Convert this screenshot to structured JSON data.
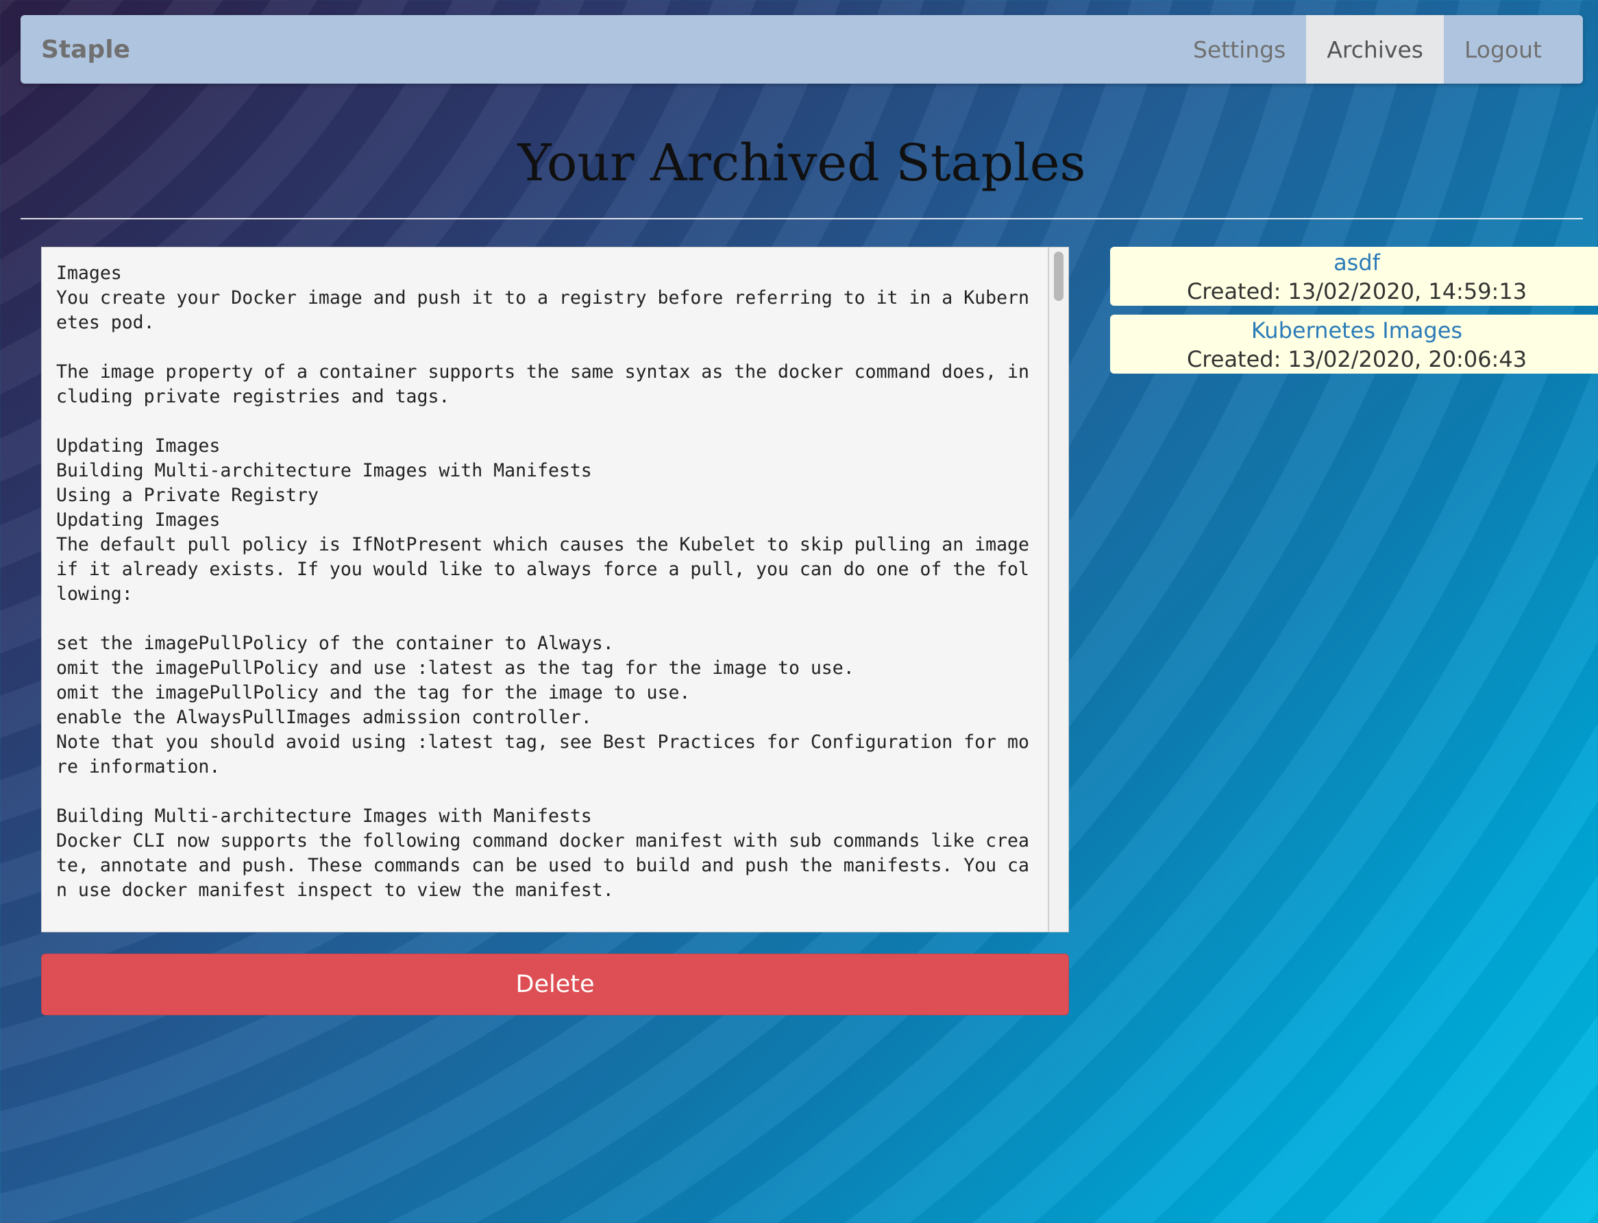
{
  "navbar": {
    "brand": "Staple",
    "links": [
      {
        "label": "Settings",
        "active": false
      },
      {
        "label": "Archives",
        "active": true
      },
      {
        "label": "Logout",
        "active": false
      }
    ]
  },
  "page": {
    "title": "Your Archived Staples"
  },
  "editor": {
    "content": "Images\nYou create your Docker image and push it to a registry before referring to it in a Kubernetes pod.\n\nThe image property of a container supports the same syntax as the docker command does, including private registries and tags.\n\nUpdating Images\nBuilding Multi-architecture Images with Manifests\nUsing a Private Registry\nUpdating Images\nThe default pull policy is IfNotPresent which causes the Kubelet to skip pulling an image if it already exists. If you would like to always force a pull, you can do one of the following:\n\nset the imagePullPolicy of the container to Always.\nomit the imagePullPolicy and use :latest as the tag for the image to use.\nomit the imagePullPolicy and the tag for the image to use.\nenable the AlwaysPullImages admission controller.\nNote that you should avoid using :latest tag, see Best Practices for Configuration for more information.\n\nBuilding Multi-architecture Images with Manifests\nDocker CLI now supports the following command docker manifest with sub commands like create, annotate and push. These commands can be used to build and push the manifests. You can use docker manifest inspect to view the manifest."
  },
  "actions": {
    "delete_label": "Delete"
  },
  "staples": [
    {
      "title": "asdf",
      "created": "Created: 13/02/2020, 14:59:13"
    },
    {
      "title": "Kubernetes Images",
      "created": "Created: 13/02/2020, 20:06:43"
    }
  ],
  "colors": {
    "navbar_bg": "#afc5df",
    "active_tab_bg": "#e6e7e9",
    "delete_button": "#dd4f54",
    "card_bg": "#ffffe3",
    "card_title": "#2a7bb8"
  }
}
